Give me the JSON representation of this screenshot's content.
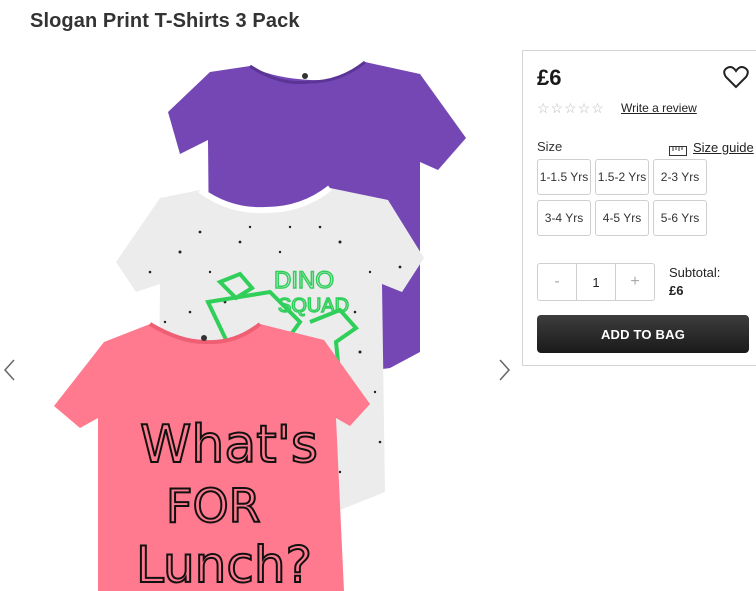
{
  "product": {
    "title": "Slogan Print T-Shirts 3 Pack",
    "price": "£6",
    "rating_stars": 5,
    "review_link": "Write a review"
  },
  "size": {
    "label": "Size",
    "guide_label": "Size guide",
    "options": [
      "1-1.5 Yrs",
      "1.5-2 Yrs",
      "2-3 Yrs",
      "3-4 Yrs",
      "4-5 Yrs",
      "5-6 Yrs"
    ]
  },
  "quantity": {
    "decrement": "-",
    "value": "1",
    "increment": "+"
  },
  "subtotal": {
    "label": "Subtotal:",
    "value": "£6"
  },
  "add_to_bag": "ADD TO BAG",
  "image_text": {
    "dino": "DINO",
    "squad": "SQUAD",
    "line1": "What's",
    "line2": "FOR",
    "line3": "Lunch?"
  },
  "colors": {
    "purple": "#7447b5",
    "grey": "#e9e9e9",
    "pink": "#ff7a8e",
    "green": "#2fcf5a"
  }
}
